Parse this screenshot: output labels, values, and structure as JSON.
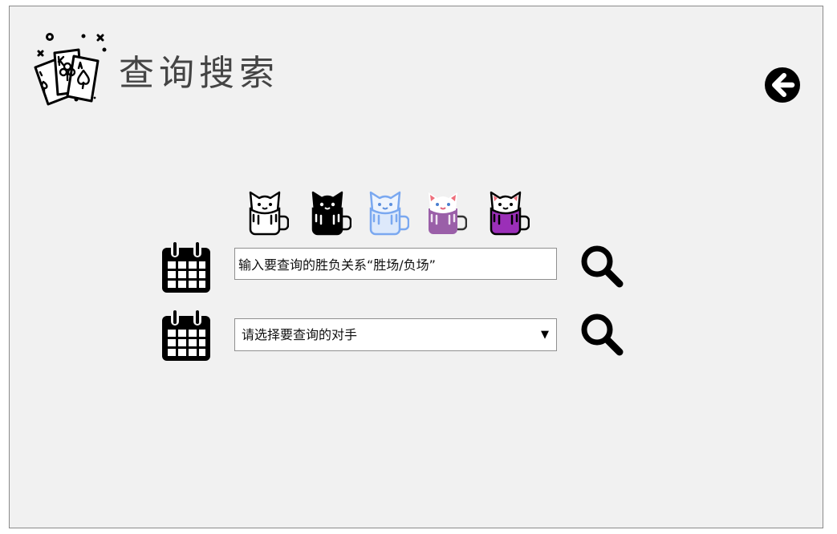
{
  "header": {
    "title": "查询搜索"
  },
  "icons": {
    "logo": "playing-cards-icon",
    "back": "back-arrow-icon",
    "calendar": "calendar-icon",
    "search": "search-icon",
    "cats": [
      "cat-mug-outline-icon",
      "cat-mug-black-icon",
      "cat-mug-blue-icon",
      "cat-mug-lavender-icon",
      "cat-mug-purple-icon"
    ]
  },
  "colors": {
    "background": "#f1f1f1",
    "cat_blue": "#7aa8f0",
    "cat_lavender": "#9a5fa8",
    "cat_purple": "#9b2fb8"
  },
  "search_form": {
    "result_input": {
      "value": "输入要查询的胜负关系“胜场/负场”"
    },
    "opponent_select": {
      "selected": "请选择要查询的对手"
    }
  }
}
